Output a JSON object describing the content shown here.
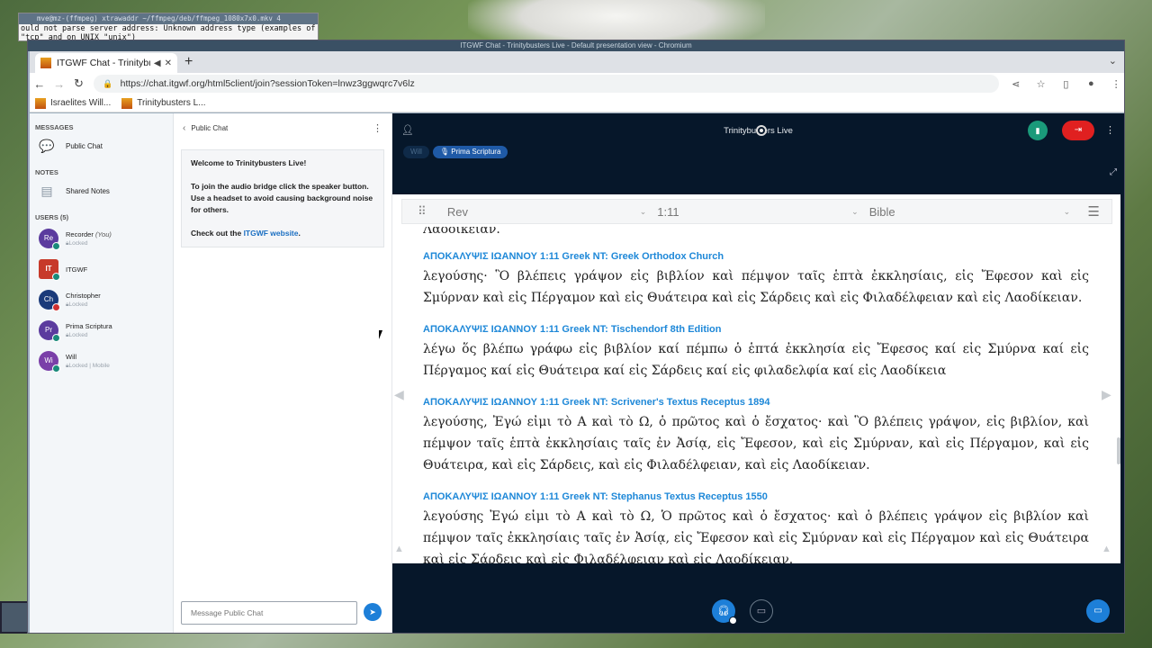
{
  "terminal": {
    "title": "mve@mz-(ffmpeg) xtrawaddr ~/ffmpeg/deb/ffmpeg_1080x7x0.mkv 4",
    "lines": [
      "ould not parse server address: Unknown address type (examples of valid types are",
      "\"tcp\" and on UNIX \"unix\")"
    ]
  },
  "window": {
    "title": "ITGWF Chat - Trinitybusters Live - Default presentation view - Chromium"
  },
  "browser": {
    "tab_title": "ITGWF Chat - Trinitybus",
    "url": "https://chat.itgwf.org/html5client/join?sessionToken=lnwz3ggwqrc7v6lz",
    "bookmarks": [
      {
        "label": "Israelites Will..."
      },
      {
        "label": "Trinitybusters L..."
      }
    ]
  },
  "sidebar": {
    "messages_header": "MESSAGES",
    "public_chat": "Public Chat",
    "notes_header": "NOTES",
    "shared_notes": "Shared Notes",
    "users_header": "USERS (5)",
    "users": [
      {
        "initials": "Re",
        "name": "Recorder",
        "you": "(You)",
        "status": "Locked",
        "color": "#5b3b9e",
        "dot": "#1a8a7a"
      },
      {
        "initials": "",
        "name": "ITGWF",
        "you": "",
        "status": "",
        "color": "#c73a2a",
        "dot": "#1a8a7a"
      },
      {
        "initials": "Ch",
        "name": "Christopher",
        "you": "",
        "status": "Locked",
        "color": "#1a3a7a",
        "dot": "#d03030"
      },
      {
        "initials": "Pr",
        "name": "Prima Scriptura",
        "you": "",
        "status": "Locked",
        "color": "#5b3b9e",
        "dot": "#1a8a7a"
      },
      {
        "initials": "Wi",
        "name": "Will",
        "you": "",
        "status": "Locked | Mobile",
        "color": "#7a3fa8",
        "dot": "#1a8a7a"
      }
    ]
  },
  "chat": {
    "title": "Public Chat",
    "welcome_prefix": "Welcome to ",
    "welcome_name": "Trinitybusters Live!",
    "paragraph1": "To join the audio bridge click the speaker button. Use a headset to avoid causing background noise for others.",
    "paragraph2_prefix": "Check out the ",
    "paragraph2_link": "ITGWF website",
    "paragraph2_suffix": ".",
    "placeholder": "Message Public Chat"
  },
  "meeting": {
    "title": "Trinitybusters Live",
    "talkers": [
      "Will",
      "Prima Scriptura"
    ]
  },
  "presentation": {
    "book": "Rev",
    "verse": "1:11",
    "source": "Bible",
    "partial_line": "Λαοδίκειαν.",
    "verses": [
      {
        "source": "ΑΠΟΚΑΛΥΨΙΣ ΙΩΑΝΝΟΥ 1:11 Greek NT: Greek Orthodox Church",
        "text": "λεγούσης· Ὃ βλέπεις γράψον εἰς βιβλίον καὶ πέμψον ταῖς ἑπτὰ ἐκκλησίαις, εἰς Ἔφεσον καὶ εἰς Σμύρναν καὶ εἰς Πέργαμον καὶ εἰς Θυάτειρα καὶ εἰς Σάρδεις καὶ εἰς Φιλαδέλφειαν καὶ εἰς Λαοδίκειαν."
      },
      {
        "source": "ΑΠΟΚΑΛΥΨΙΣ ΙΩΑΝΝΟΥ 1:11 Greek NT: Tischendorf 8th Edition",
        "text": "λέγω ὅς βλέπω γράφω εἰς βιβλίον καί πέμπω ὁ ἑπτά ἐκκλησία εἰς Ἔφεσος καί εἰς Σμύρνα καί εἰς Πέργαμος καί εἰς Θυάτειρα καί εἰς Σάρδεις καί εἰς φιλαδελφία καί εἰς Λαοδίκεια"
      },
      {
        "source": "ΑΠΟΚΑΛΥΨΙΣ ΙΩΑΝΝΟΥ 1:11 Greek NT: Scrivener's Textus Receptus 1894",
        "text": "λεγούσης, Ἐγώ εἰμι τὸ Α καὶ τὸ Ω, ὁ πρῶτος καὶ ὁ ἔσχατος· καὶ Ὃ βλέπεις γράψον, εἰς βιβλίον, καὶ πέμψον ταῖς ἑπτὰ ἐκκλησίαις ταῖς ἐν Ἀσίᾳ, εἰς Ἔφεσον, καὶ εἰς Σμύρναν, καὶ εἰς Πέργαμον, καὶ εἰς Θυάτειρα, καὶ εἰς Σάρδεις, καὶ εἰς Φιλαδέλφειαν, καὶ εἰς Λαοδίκειαν."
      },
      {
        "source": "ΑΠΟΚΑΛΥΨΙΣ ΙΩΑΝΝΟΥ 1:11 Greek NT: Stephanus Textus Receptus 1550",
        "text": "λεγούσης Ἐγώ εἰμι τὸ Α καὶ τὸ Ω, Ὁ πρῶτος καὶ ὁ ἔσχατος· καὶ ὁ βλέπεις γράψον εἰς βιβλίον καὶ πέμψον ταῖς ἐκκλησίαις ταῖς ἐν Ἀσίᾳ, εἰς Ἔφεσον καὶ εἰς Σμύρναν καὶ εἰς Πέργαμον καὶ εἰς Θυάτειρα καὶ εἰς Σάρδεις καὶ εἰς Φιλαδέλφειαν καὶ εἰς Λαοδίκειαν."
      }
    ]
  },
  "colors": {
    "accent": "#1d7fd8",
    "leave": "#e02020",
    "connection": "#1a9a7a",
    "verse_source": "#1e88d8"
  }
}
